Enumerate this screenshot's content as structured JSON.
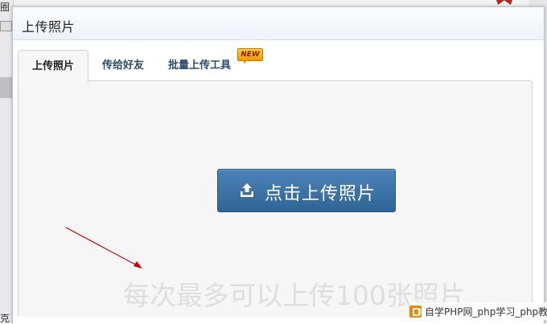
{
  "dialog": {
    "title": "上传照片"
  },
  "tabs": [
    {
      "label": "上传照片",
      "active": true
    },
    {
      "label": "传给好友",
      "active": false
    },
    {
      "label": "批量上传工具",
      "active": false,
      "badge": "NEW"
    }
  ],
  "upload": {
    "button_label": "点击上传照片",
    "icon": "upload-icon",
    "hint": "每次最多可以上传100张照片"
  },
  "background": {
    "left_char_top": "圈",
    "left_char_bottom": "克"
  },
  "watermark": {
    "text": "自学PHP网_php学习_php教"
  },
  "colors": {
    "accent_button": "#3a6fa3",
    "tab_text": "#2b4a6b",
    "annotation_arrow": "#cc0000",
    "badge": "#f5b000"
  }
}
